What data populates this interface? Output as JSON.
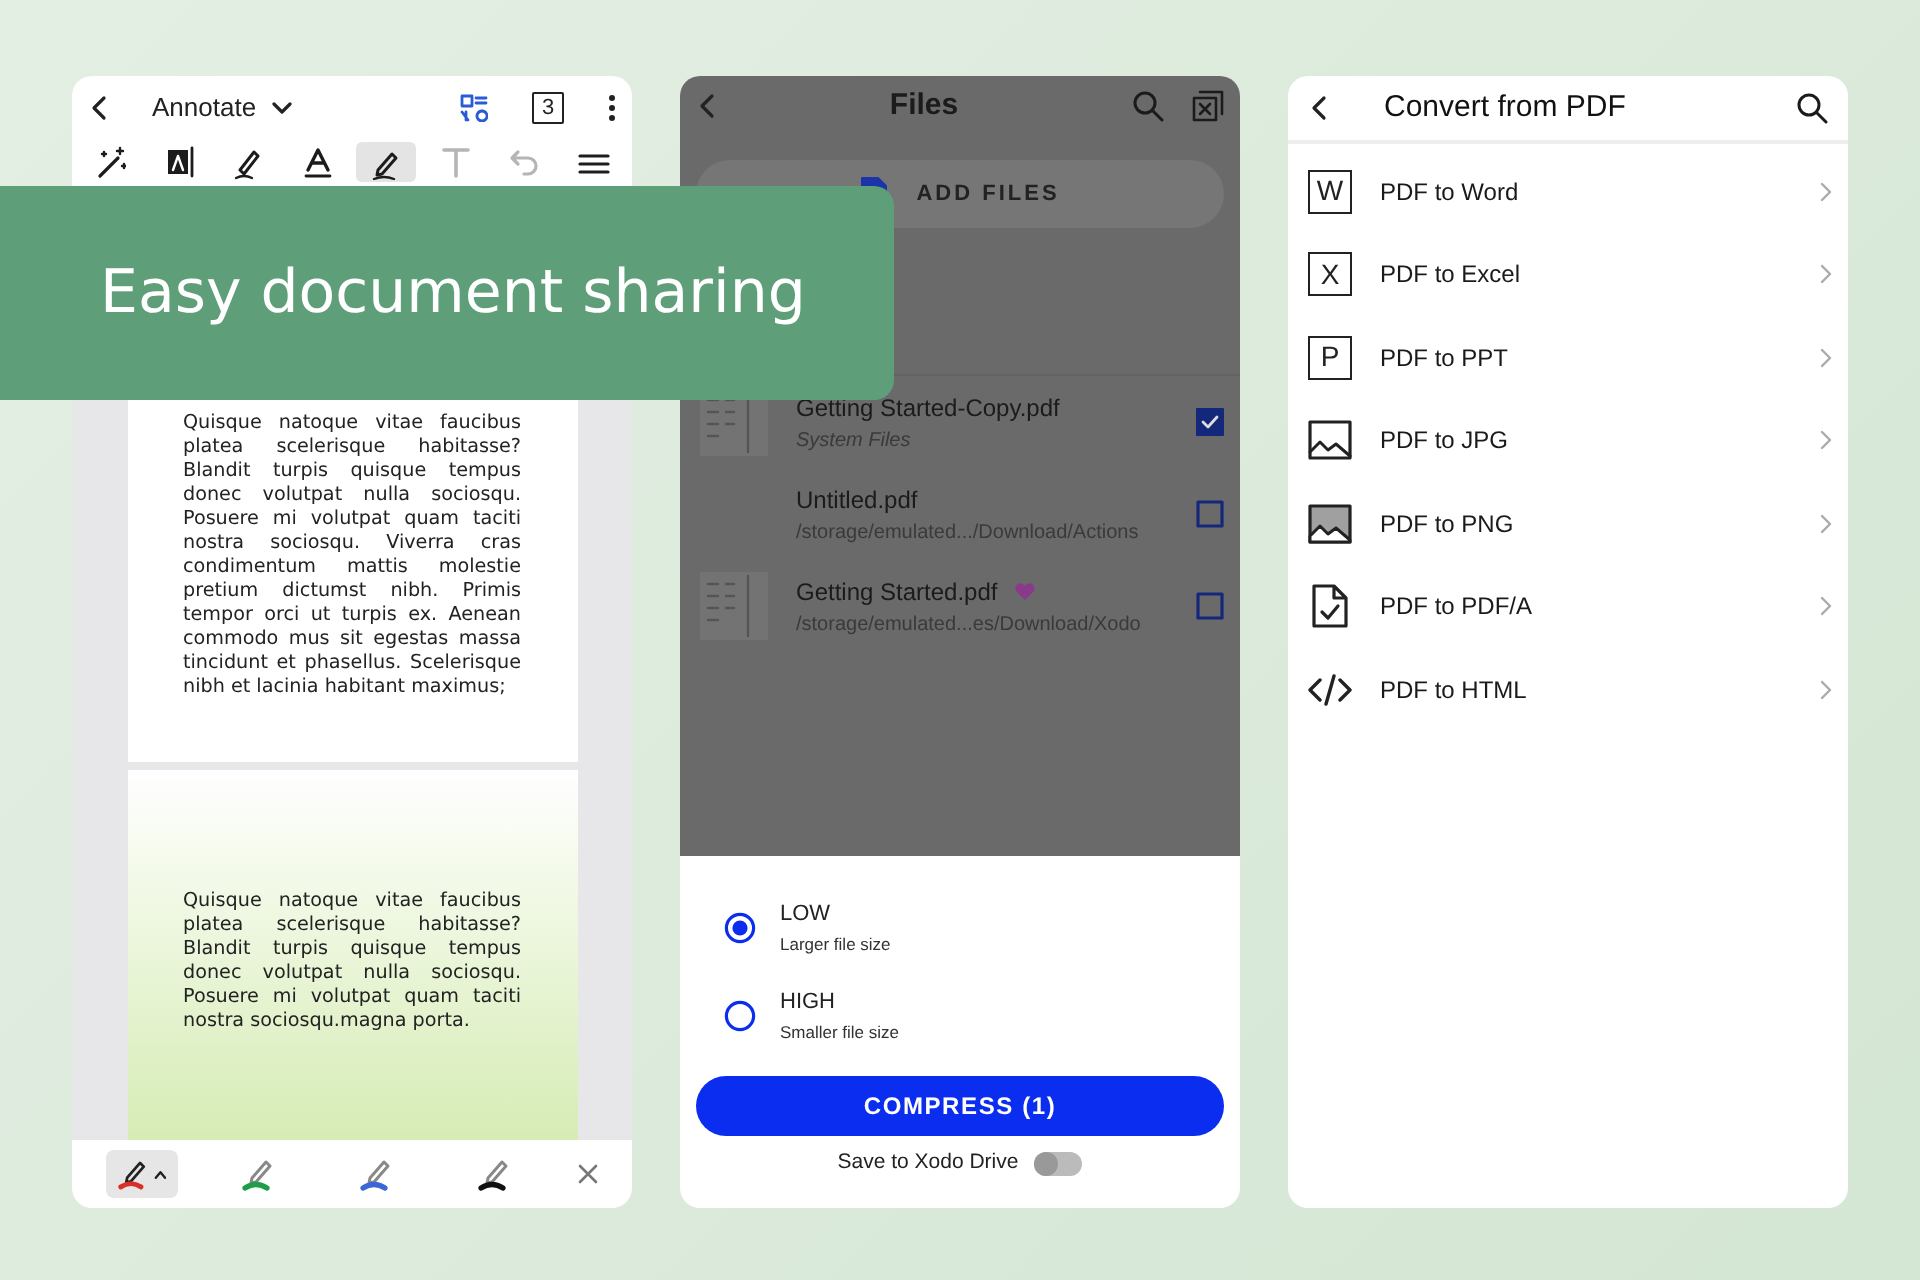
{
  "banner": {
    "title": "Easy document sharing"
  },
  "annotate": {
    "mode": "Annotate",
    "page_count": "3",
    "tools": [
      {
        "kind": "wand",
        "selected": false,
        "disabled": false
      },
      {
        "kind": "textbox",
        "selected": false,
        "disabled": false
      },
      {
        "kind": "highlighter",
        "selected": false,
        "disabled": false
      },
      {
        "kind": "textcolor",
        "selected": false,
        "disabled": false
      },
      {
        "kind": "pen",
        "selected": true,
        "disabled": false
      },
      {
        "kind": "text",
        "selected": false,
        "disabled": true
      },
      {
        "kind": "undo",
        "selected": false,
        "disabled": true
      },
      {
        "kind": "menu",
        "selected": false,
        "disabled": false
      }
    ],
    "pages": [
      {
        "kind": "plain",
        "text": "Quisque natoque vitae faucibus platea scelerisque habitasse? Blandit turpis quisque tempus donec volutpat nulla sociosqu. Posuere mi volutpat quam taciti nostra sociosqu. Viverra cras condimentum mattis molestie pretium dictumst nibh. Primis tempor orci ut turpis ex. Aenean commodo mus sit egestas massa tincidunt et phasellus. Scelerisque nibh et lacinia habitant maximus;"
      },
      {
        "kind": "tinted",
        "text": "Quisque natoque vitae faucibus platea scelerisque habitasse? Blandit turpis quisque tempus donec volutpat nulla sociosqu. Posuere mi volutpat quam taciti nostra sociosqu.magna porta."
      }
    ],
    "pens": [
      {
        "color": "#d93025",
        "selected": true
      },
      {
        "color": "#1e9e4a",
        "selected": false
      },
      {
        "color": "#3a66d6",
        "selected": false
      },
      {
        "color": "#111111",
        "selected": false
      }
    ]
  },
  "files": {
    "title": "Files",
    "add_label": "ADD FILES",
    "items": [
      {
        "name": "Getting Started-Copy.pdf",
        "location": "System Files",
        "kind": "system",
        "thumbnail": true,
        "favorite": false,
        "checked": true
      },
      {
        "name": "Untitled.pdf",
        "location": "/storage/emulated.../Download/Actions",
        "kind": "path",
        "thumbnail": false,
        "favorite": false,
        "checked": false
      },
      {
        "name": "Getting Started.pdf",
        "location": "/storage/emulated...es/Download/Xodo",
        "kind": "path",
        "thumbnail": true,
        "favorite": true,
        "checked": false
      }
    ],
    "options": [
      {
        "label": "LOW",
        "hint": "Larger file size",
        "selected": true
      },
      {
        "label": "HIGH",
        "hint": "Smaller file size",
        "selected": false
      }
    ],
    "compress_label": "COMPRESS (1)",
    "drive": {
      "label": "Save to Xodo Drive",
      "on": false
    }
  },
  "convert": {
    "title": "Convert from PDF",
    "items": [
      {
        "kind": "letter",
        "icon_text": "W",
        "label": "PDF to Word"
      },
      {
        "kind": "letter",
        "icon_text": "X",
        "label": "PDF to Excel"
      },
      {
        "kind": "letter",
        "icon_text": "P",
        "label": "PDF to PPT"
      },
      {
        "kind": "image",
        "label": "PDF to JPG"
      },
      {
        "kind": "image-filled",
        "label": "PDF to PNG"
      },
      {
        "kind": "pdfa",
        "label": "PDF to PDF/A"
      },
      {
        "kind": "code",
        "label": "PDF to HTML"
      }
    ]
  }
}
